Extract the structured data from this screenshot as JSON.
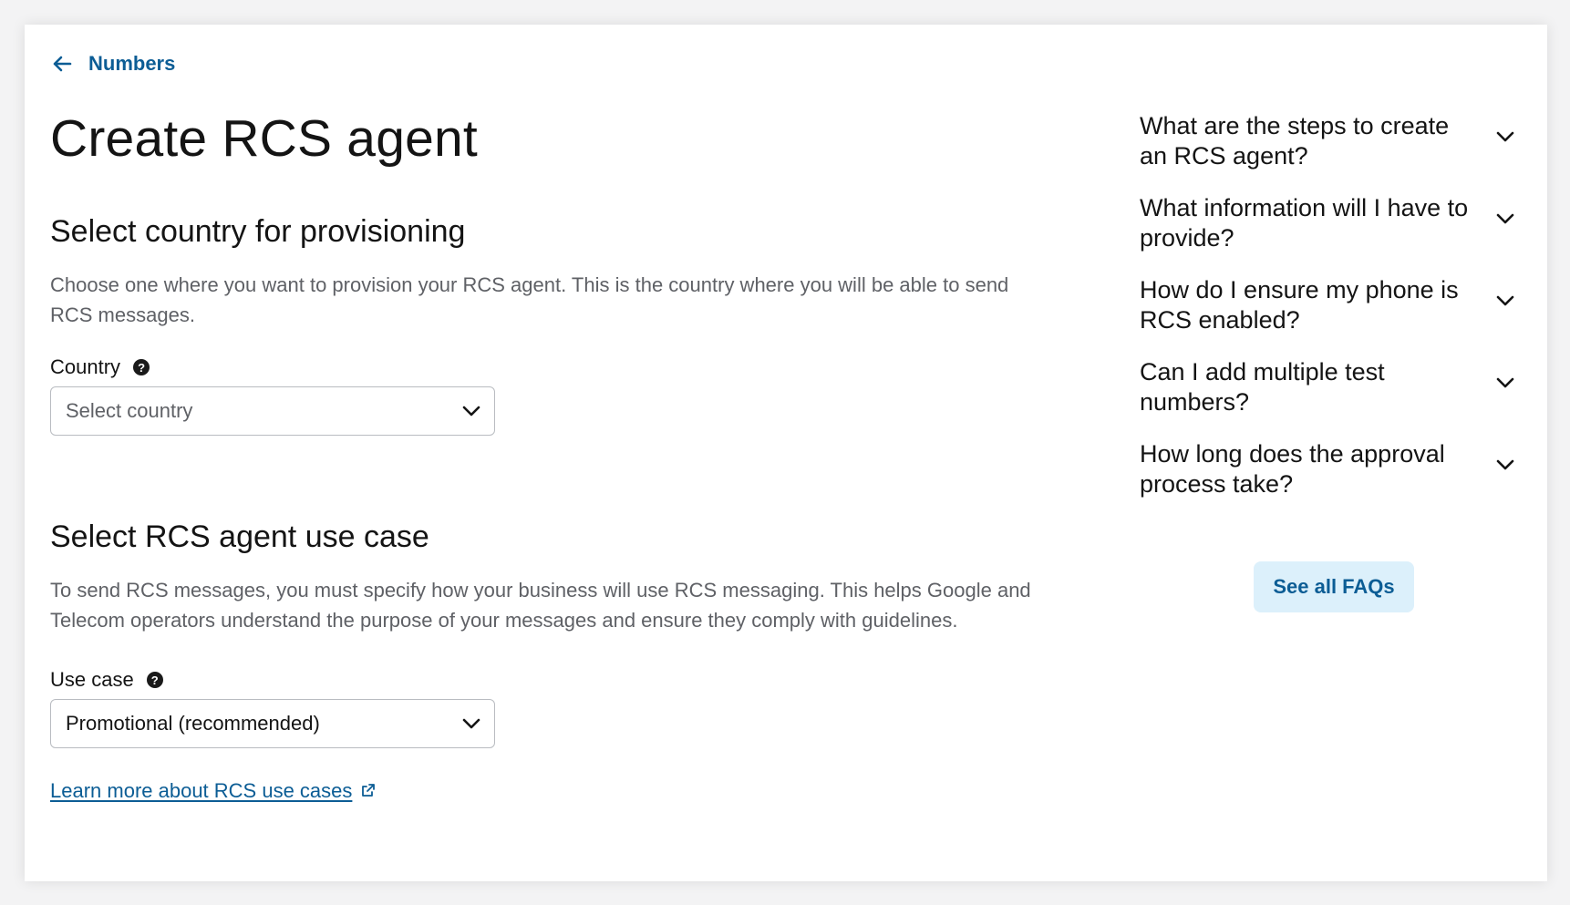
{
  "nav": {
    "back_label": "Numbers"
  },
  "page": {
    "title": "Create RCS agent"
  },
  "country_section": {
    "heading": "Select country for provisioning",
    "description": "Choose one where you want to provision your RCS agent. This is the country where you will be able to send RCS messages.",
    "field_label": "Country",
    "select_placeholder": "Select country"
  },
  "use_case_section": {
    "heading": "Select RCS agent use case",
    "description": "To send RCS messages, you must specify how your business will use RCS messaging. This helps Google and Telecom operators understand the purpose of your messages and ensure they comply with guidelines.",
    "field_label": "Use case",
    "select_value": "Promotional (recommended)",
    "learn_more_label": "Learn more about RCS use cases"
  },
  "faq": {
    "items": [
      {
        "question": "What are the steps to create an RCS agent?"
      },
      {
        "question": "What information will I have to provide?"
      },
      {
        "question": "How do I ensure my phone is RCS enabled?"
      },
      {
        "question": "Can I add multiple test numbers?"
      },
      {
        "question": "How long does the approval process take?"
      }
    ],
    "see_all_label": "See all FAQs"
  },
  "icons": {
    "back": "arrow-left-icon",
    "help": "question-circle-icon",
    "dropdown": "chevron-down-icon",
    "external": "external-link-icon"
  },
  "colors": {
    "link": "#0c5d95",
    "faq_button_bg": "#dcf0fb",
    "text_primary": "#141414",
    "text_secondary": "#5f6166"
  }
}
